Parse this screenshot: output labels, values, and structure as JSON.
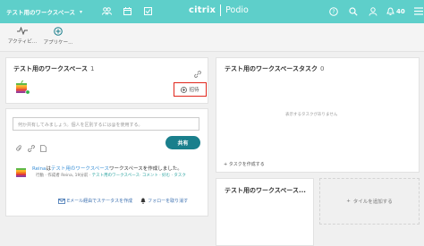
{
  "topbar": {
    "workspace_title": "テスト用のワークスペース",
    "brand_left": "citrix",
    "brand_right": "Podio",
    "notification_count": "40"
  },
  "appbar": {
    "activity_label": "アクティビ...",
    "apps_label": "アプリケー..."
  },
  "workspace_card": {
    "title": "テスト用のワークスペース",
    "member_count": "1",
    "invite_label": "招待"
  },
  "share_card": {
    "input_placeholder": "何か共有してみましょう。個人を区別するには@を使用する。",
    "share_button": "共有",
    "activity": {
      "user": "Reina",
      "text1": "は",
      "workspace_link": "テスト用のワークスペース",
      "text2": "ワークスペースを作成しました。",
      "sub_prefix": "行動 · 作成者 Reina, 19分前 · ",
      "sub_link": "テスト用のワークスペース",
      "sub_actions": "· コメント · 好む · タスク"
    },
    "email_link": "Eメール経由でステータスを作成",
    "follow_link": "フォローを取り消す"
  },
  "task_card": {
    "title": "テスト用のワークスペースタスク",
    "count": "0",
    "empty_text": "表示するタスクがありません",
    "add_task": "+ タスクを作成する"
  },
  "app_card": {
    "title": "テスト用のワークスペース..."
  },
  "add_tile": {
    "label": "タイルを追加する"
  },
  "colors": {
    "topbar": "#5ecfca",
    "accent": "#1a7f8c",
    "highlight": "#e0261c"
  }
}
